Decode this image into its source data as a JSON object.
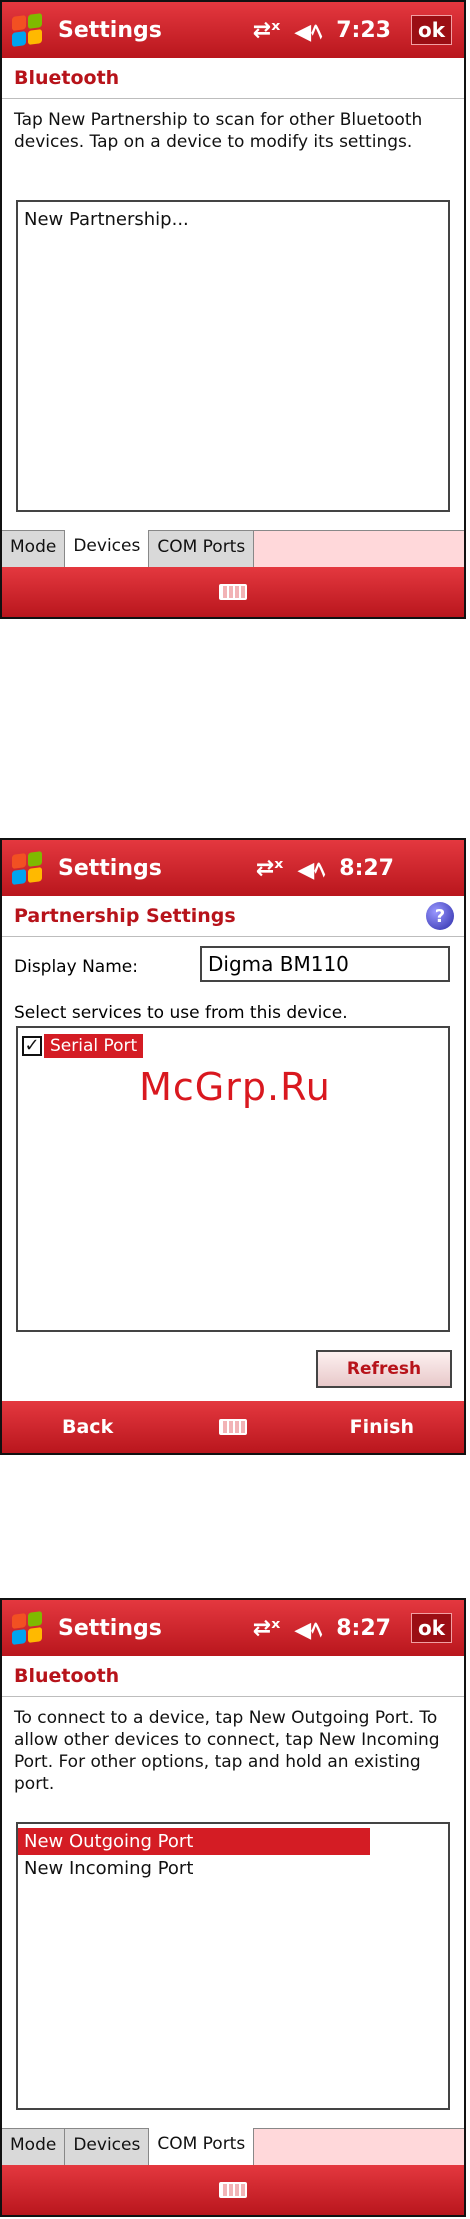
{
  "screen1": {
    "title": "Settings",
    "time": "7:23",
    "ok_label": "ok",
    "heading": "Bluetooth",
    "description": "Tap New Partnership to scan for other Bluetooth devices. Tap on a device to modify its settings.",
    "list_items": [
      "New Partnership..."
    ],
    "tabs": [
      "Mode",
      "Devices",
      "COM Ports"
    ],
    "active_tab": "Devices"
  },
  "screen2": {
    "title": "Settings",
    "time": "8:27",
    "heading": "Partnership Settings",
    "display_name_label": "Display Name:",
    "display_name_value": "Digma BM110",
    "services_label": "Select services to use from this device.",
    "services": [
      {
        "label": "Serial Port",
        "checked": true
      }
    ],
    "refresh_label": "Refresh",
    "back_label": "Back",
    "finish_label": "Finish"
  },
  "screen3": {
    "title": "Settings",
    "time": "8:27",
    "ok_label": "ok",
    "heading": "Bluetooth",
    "description": "To connect to a device, tap New Outgoing Port. To allow other devices to connect, tap New Incoming Port. For other options, tap and hold an existing port.",
    "list_items": [
      "New Outgoing Port",
      "New Incoming Port"
    ],
    "tabs": [
      "Mode",
      "Devices",
      "COM Ports"
    ],
    "active_tab": "COM Ports"
  },
  "watermark": "McGrp.Ru",
  "colors": {
    "accent": "#d41c24",
    "titlebar": "#c91f26",
    "heading_text": "#b7131a"
  },
  "icons": [
    "windows-start-icon",
    "connectivity-icon",
    "speaker-icon",
    "keyboard-icon",
    "help-icon"
  ]
}
